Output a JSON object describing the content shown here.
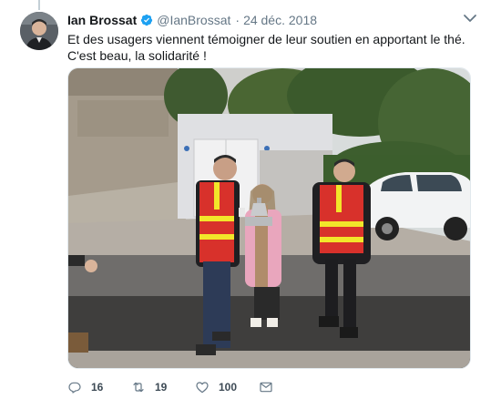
{
  "tweet": {
    "display_name": "Ian Brossat",
    "handle": "@IanBrossat",
    "separator": "·",
    "date": "24 déc. 2018",
    "text_line1": "Et des usagers viennent témoigner de leur soutien en apportant le thé.",
    "text_line2": "C'est beau, la solidarité !",
    "verified": true
  },
  "actions": {
    "replies": "16",
    "retweets": "19",
    "likes": "100"
  },
  "icons": {
    "verified": "verified-badge-icon",
    "caret": "chevron-down-icon",
    "reply": "reply-icon",
    "retweet": "retweet-icon",
    "like": "heart-icon",
    "dm": "envelope-icon"
  },
  "colors": {
    "verified_blue": "#1da1f2",
    "vest_red": "#d8312b",
    "vest_yellow": "#f2e62a",
    "text_secondary": "#657786"
  }
}
